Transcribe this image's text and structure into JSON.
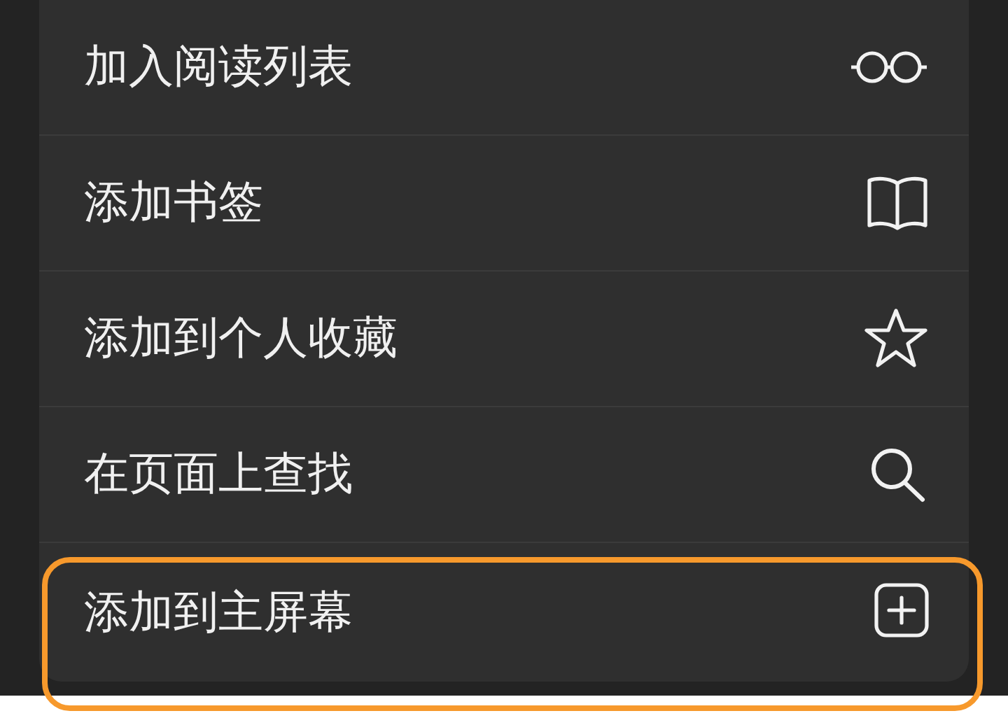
{
  "menu": {
    "items": [
      {
        "label": "加入阅读列表",
        "kind": "glasses",
        "highlighted": false
      },
      {
        "label": "添加书签",
        "kind": "book",
        "highlighted": false
      },
      {
        "label": "添加到个人收藏",
        "kind": "star",
        "highlighted": false
      },
      {
        "label": "在页面上查找",
        "kind": "search",
        "highlighted": false
      },
      {
        "label": "添加到主屏幕",
        "kind": "plus",
        "highlighted": true
      }
    ]
  }
}
